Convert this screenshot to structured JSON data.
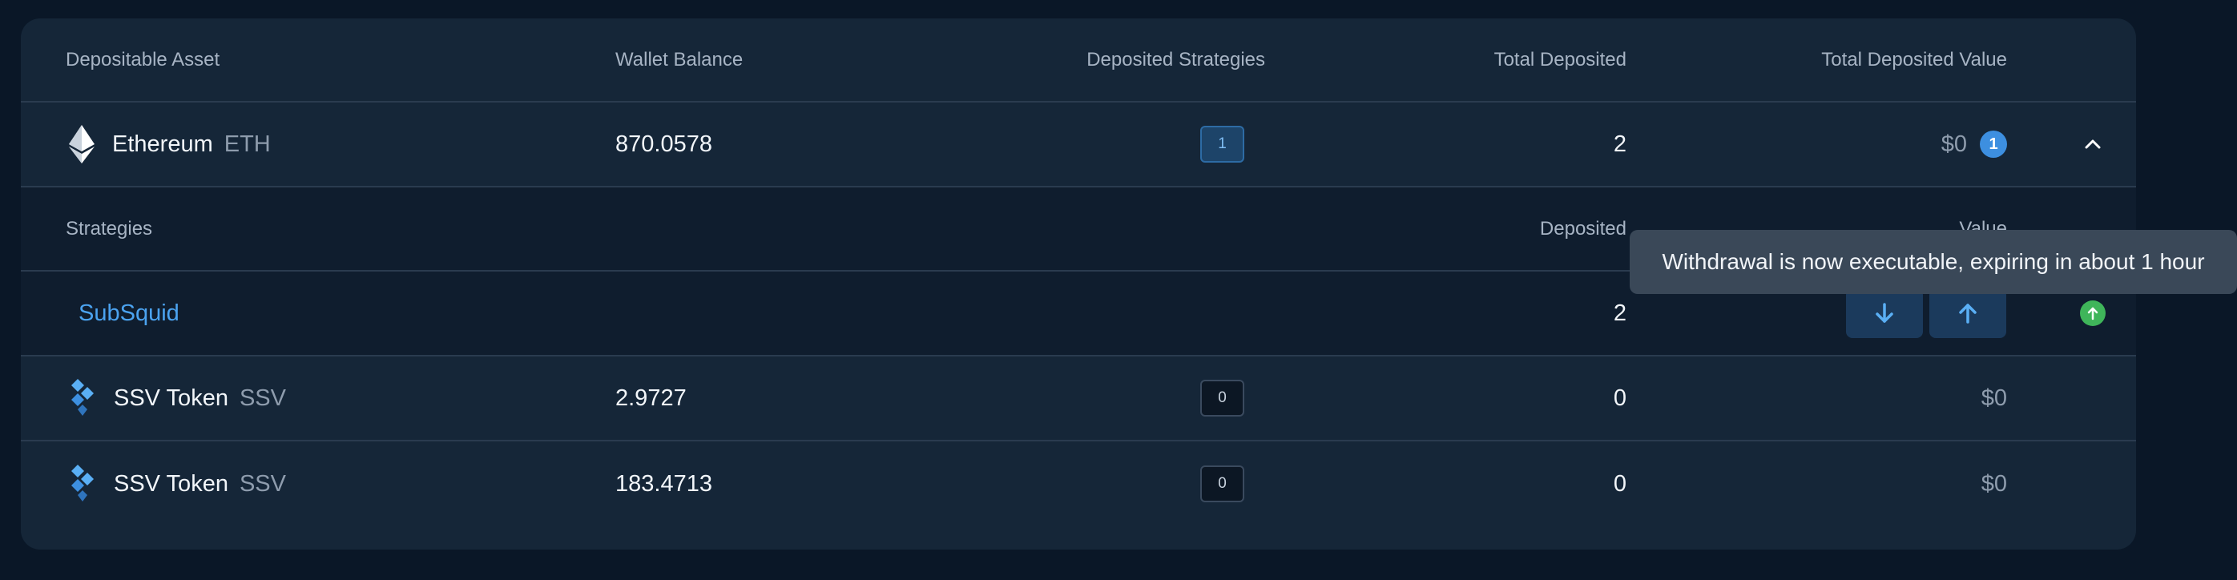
{
  "table": {
    "headers": {
      "asset": "Depositable Asset",
      "wallet_balance": "Wallet Balance",
      "deposited_strategies": "Deposited Strategies",
      "total_deposited": "Total Deposited",
      "total_deposited_value": "Total Deposited Value"
    },
    "rows": [
      {
        "name": "Ethereum",
        "symbol": "ETH",
        "icon": "ethereum-icon",
        "wallet_balance": "870.0578",
        "strategies": "1",
        "total_deposited": "2",
        "value": "$0",
        "info_count": "1",
        "expanded": true
      },
      {
        "name": "SSV Token",
        "symbol": "SSV",
        "icon": "ssv-token-icon",
        "wallet_balance": "2.9727",
        "strategies": "0",
        "total_deposited": "0",
        "value": "$0"
      },
      {
        "name": "SSV Token",
        "symbol": "SSV",
        "icon": "ssv-token-icon",
        "wallet_balance": "183.4713",
        "strategies": "0",
        "total_deposited": "0",
        "value": "$0"
      }
    ]
  },
  "strategies_panel": {
    "headers": {
      "strategies": "Strategies",
      "deposited": "Deposited",
      "value": "Value"
    },
    "items": [
      {
        "name": "SubSquid",
        "deposited": "2",
        "status_icon": "arrow-up-circle-icon"
      }
    ]
  },
  "tooltip": {
    "text": "Withdrawal is now executable, expiring in about 1 hour"
  },
  "colors": {
    "page_bg": "#0a1727",
    "card_bg": "#152638",
    "link": "#4ba3f0",
    "accent_blue": "#3d8fe0",
    "success": "#3fb55a"
  }
}
